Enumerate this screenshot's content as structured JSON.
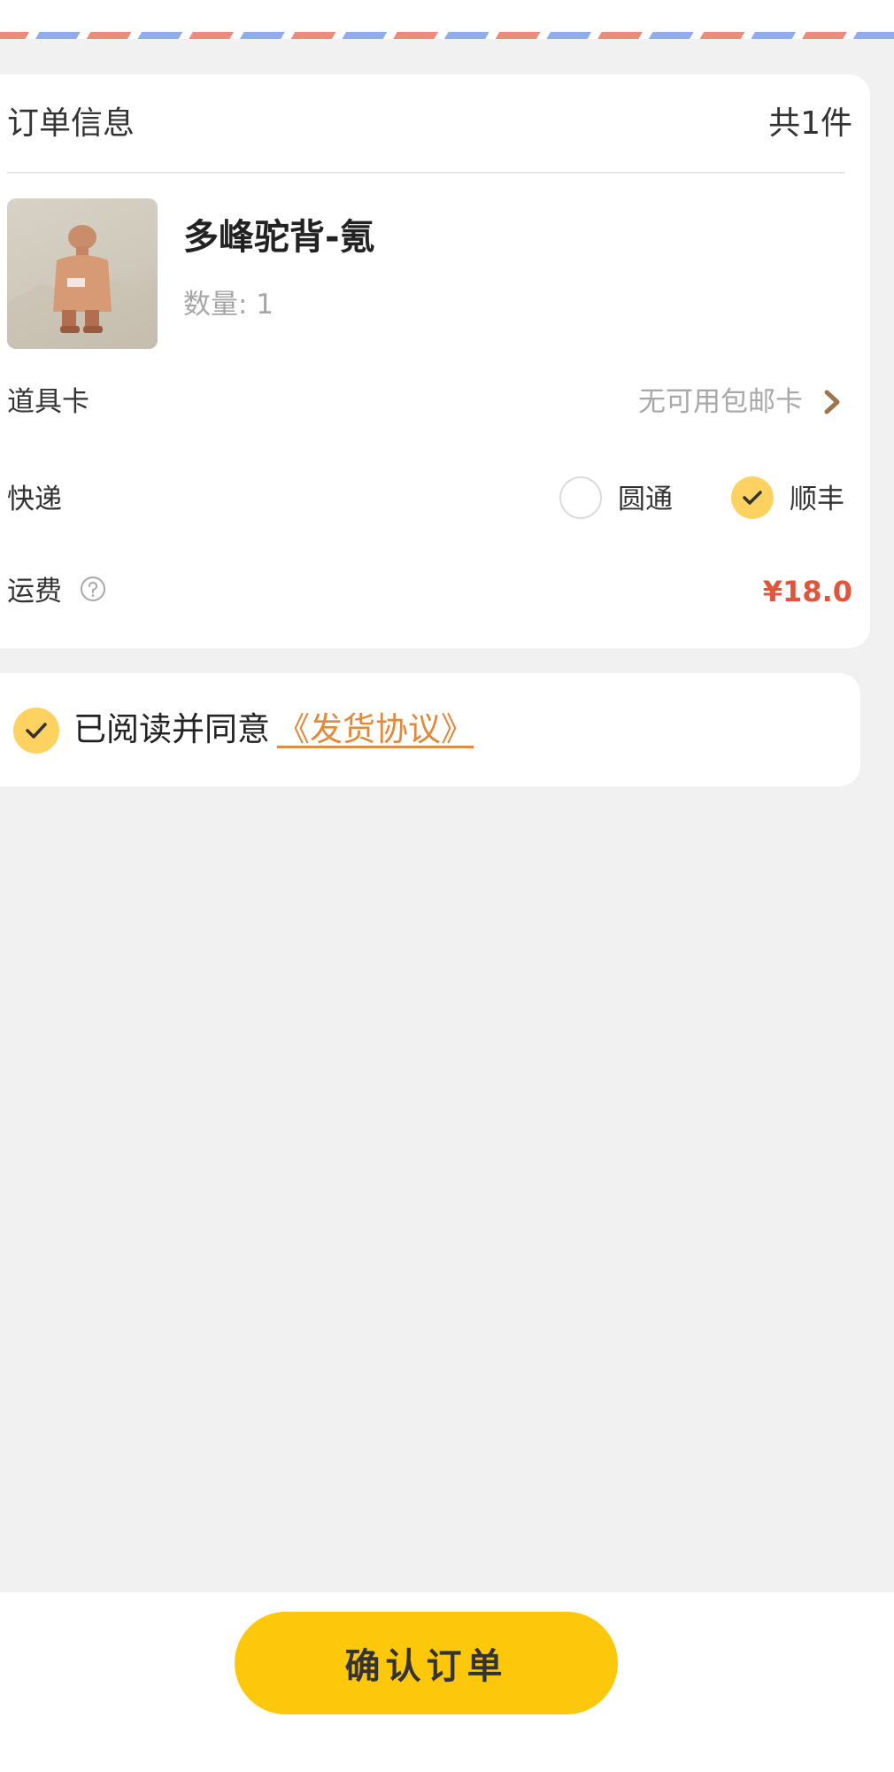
{
  "order": {
    "title": "订单信息",
    "count": "共1件",
    "product": {
      "name": "多峰驼背-氪",
      "quantity": "数量: 1"
    },
    "prop_card": {
      "label": "道具卡",
      "value": "无可用包邮卡"
    },
    "express": {
      "label": "快递",
      "options": [
        {
          "label": "圆通",
          "selected": false
        },
        {
          "label": "顺丰",
          "selected": true
        }
      ]
    },
    "shipping": {
      "label": "运费",
      "amount": "¥18.0"
    }
  },
  "agreement": {
    "checked": true,
    "text": "已阅读并同意",
    "link": "《发货协议》"
  },
  "footer": {
    "confirm_label": "确认订单"
  },
  "colors": {
    "accent": "#fdc80c",
    "check": "#fdd260",
    "price": "#e0553b",
    "link": "#e08a3c"
  }
}
